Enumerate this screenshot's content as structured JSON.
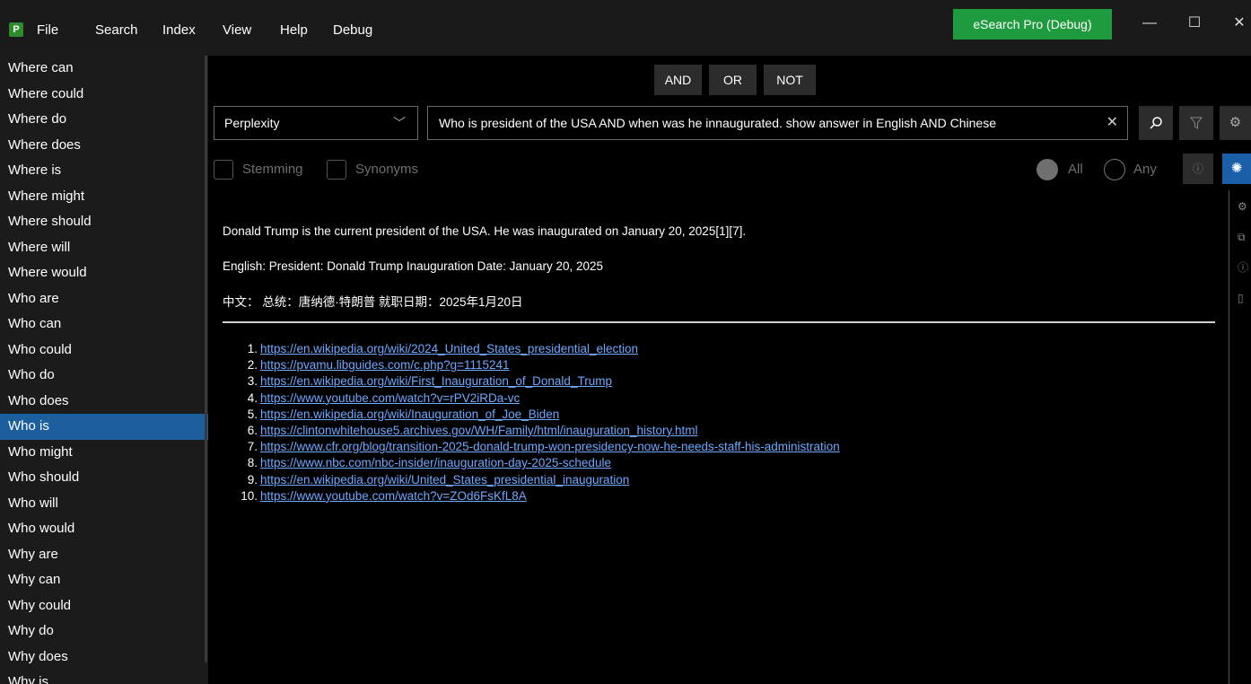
{
  "menu": [
    "File",
    "Search",
    "Index",
    "View",
    "Help",
    "Debug"
  ],
  "app_badge": "eSearch Pro (Debug)",
  "window_controls": {
    "minimize": "—",
    "maximize": "☐",
    "close": "✕"
  },
  "sidebar": {
    "items": [
      "Where can",
      "Where could",
      "Where do",
      "Where does",
      "Where is",
      "Where might",
      "Where should",
      "Where will",
      "Where would",
      "Who are",
      "Who can",
      "Who could",
      "Who do",
      "Who does",
      "Who is",
      "Who might",
      "Who should",
      "Who will",
      "Who would",
      "Why are",
      "Why can",
      "Why could",
      "Why do",
      "Why does",
      "Why is"
    ],
    "selected": "Who is"
  },
  "operators": [
    "AND",
    "OR",
    "NOT"
  ],
  "engine_select": {
    "value": "Perplexity",
    "chevron_icon": "chevron-down-icon"
  },
  "search": {
    "query": "Who is president of the USA AND when was he innaugurated. show answer in English AND Chinese",
    "clear_icon": "close-icon"
  },
  "options": {
    "stemming": "Stemming",
    "synonyms": "Synonyms",
    "all": "All",
    "any": "Any",
    "match_mode": "All"
  },
  "answer": {
    "line1": "Donald Trump is the current president of the USA. He was inaugurated on January 20, 2025[1][7].",
    "line2": "English: President: Donald Trump Inauguration Date: January 20, 2025",
    "line3": "中文： 总统：唐纳德·特朗普 就职日期：2025年1月20日"
  },
  "references": [
    {
      "num": "1.",
      "url": "https://en.wikipedia.org/wiki/2024_United_States_presidential_election"
    },
    {
      "num": "2.",
      "url": "https://pvamu.libguides.com/c.php?g=1115241"
    },
    {
      "num": "3.",
      "url": "https://en.wikipedia.org/wiki/First_Inauguration_of_Donald_Trump"
    },
    {
      "num": "4.",
      "url": "https://www.youtube.com/watch?v=rPV2iRDa-vc"
    },
    {
      "num": "5.",
      "url": "https://en.wikipedia.org/wiki/Inauguration_of_Joe_Biden"
    },
    {
      "num": "6.",
      "url": "https://clintonwhitehouse5.archives.gov/WH/Family/html/inauguration_history.html"
    },
    {
      "num": "7.",
      "url": "https://www.cfr.org/blog/transition-2025-donald-trump-won-presidency-now-he-needs-staff-his-administration"
    },
    {
      "num": "8.",
      "url": "https://www.nbc.com/nbc-insider/inauguration-day-2025-schedule"
    },
    {
      "num": "9.",
      "url": "https://en.wikipedia.org/wiki/United_States_presidential_inauguration"
    },
    {
      "num": "10.",
      "url": "https://www.youtube.com/watch?v=ZOd6FsKfL8A"
    }
  ],
  "colors": {
    "accent": "#1a5fa8",
    "badge": "#1e9b3e",
    "selected_row": "#1c5f9f",
    "link": "#6fa8ff"
  }
}
